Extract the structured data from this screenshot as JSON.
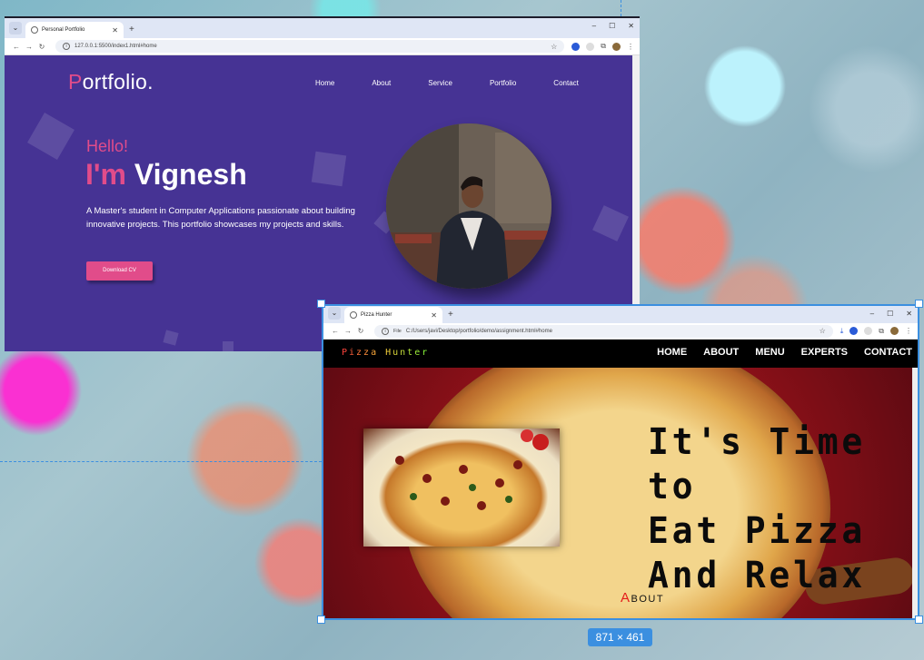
{
  "portfolio_window": {
    "tab_title": "Personal Portfolio",
    "url": "127.0.0.1:5500/index1.html#home",
    "logo_first": "P",
    "logo_rest": "ortfolio.",
    "nav": [
      "Home",
      "About",
      "Service",
      "Portfolio",
      "Contact"
    ],
    "hello": "Hello!",
    "im": "I'm",
    "name": "Vignesh",
    "description": "A Master's student in Computer Applications passionate about building innovative projects. This portfolio showcases my projects and skills.",
    "button": "Download CV",
    "accent_color": "#e14c8a",
    "bg_color": "#463394"
  },
  "pizza_window": {
    "tab_title": "Pizza Hunter",
    "url_prefix": "File",
    "url": "C:/Users/javi/Desktop/portfolio/demo/assignment.html#home",
    "logo": "Pizza Hunter",
    "nav": [
      "HOME",
      "ABOUT",
      "MENU",
      "EXPERTS",
      "CONTACT"
    ],
    "headline_1": "It's Time to",
    "headline_2": "Eat Pizza",
    "headline_3": "And Relax",
    "about_first": "A",
    "about_rest": "BOUT"
  },
  "window_controls": [
    "–",
    "☐",
    "✕"
  ],
  "selection_size": "871 × 461"
}
